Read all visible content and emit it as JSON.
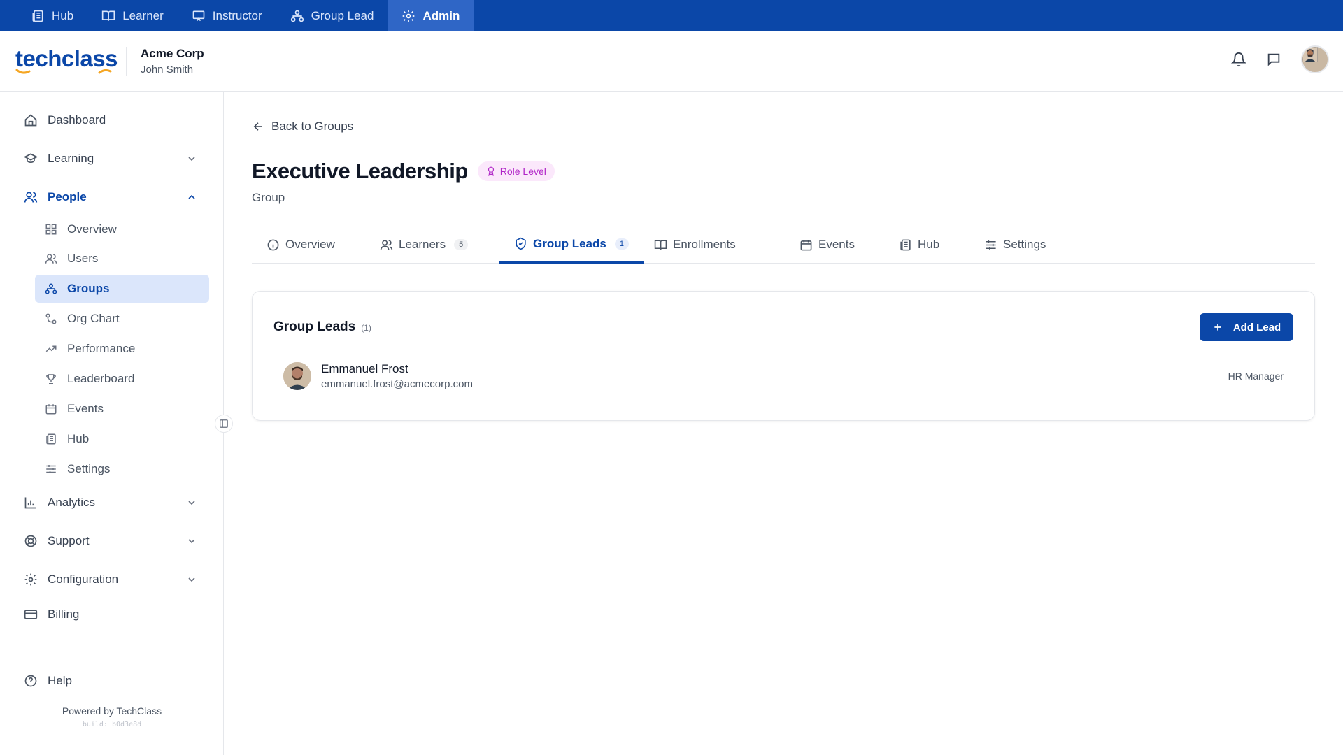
{
  "roles": [
    {
      "label": "Hub",
      "icon": "newspaper-icon"
    },
    {
      "label": "Learner",
      "icon": "book-open-icon"
    },
    {
      "label": "Instructor",
      "icon": "presentation-icon"
    },
    {
      "label": "Group Lead",
      "icon": "network-icon"
    },
    {
      "label": "Admin",
      "icon": "gear-icon",
      "active": true
    }
  ],
  "header": {
    "logo": "techclass",
    "org_name": "Acme Corp",
    "user_name": "John Smith"
  },
  "sidebar": {
    "dashboard": "Dashboard",
    "learning": "Learning",
    "people": "People",
    "people_items": [
      "Overview",
      "Users",
      "Groups",
      "Org Chart",
      "Performance",
      "Leaderboard",
      "Events",
      "Hub",
      "Settings"
    ],
    "active_people_item": "Groups",
    "analytics": "Analytics",
    "support": "Support",
    "configuration": "Configuration",
    "billing": "Billing",
    "help": "Help",
    "powered_by": "Powered by TechClass",
    "build": "build: b0d3e8d"
  },
  "main": {
    "back_label": "Back to Groups",
    "title": "Executive Leadership",
    "badge": "Role Level",
    "subtitle": "Group",
    "tabs": [
      {
        "label": "Overview"
      },
      {
        "label": "Learners",
        "count": "5"
      },
      {
        "label": "Group Leads",
        "count": "1",
        "active": true
      },
      {
        "label": "Enrollments"
      },
      {
        "label": "Events"
      },
      {
        "label": "Hub"
      },
      {
        "label": "Settings"
      }
    ],
    "card": {
      "title": "Group Leads",
      "count": "(1)",
      "add_label": "Add Lead",
      "leads": [
        {
          "name": "Emmanuel Frost",
          "email": "emmanuel.frost@acmecorp.com",
          "role": "HR Manager"
        }
      ]
    }
  },
  "colors": {
    "brand": "#0b47a8",
    "accent_orange": "#f5a623",
    "badge_purple": "#b026c7"
  }
}
